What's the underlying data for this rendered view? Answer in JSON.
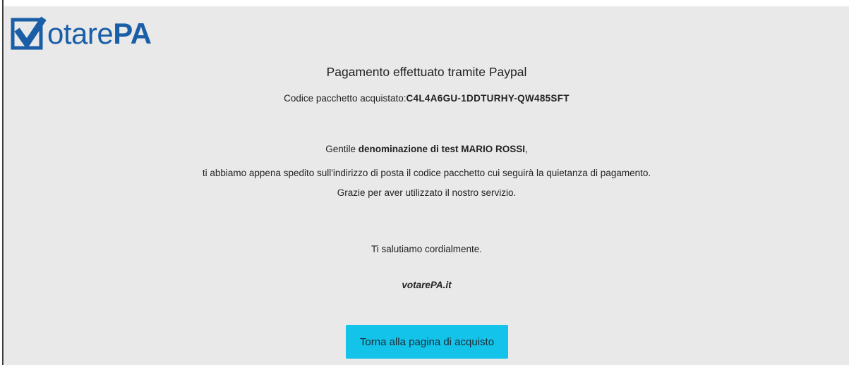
{
  "logo": {
    "text_light": "otare",
    "text_bold": "PA",
    "brand_color": "#1a5ea8",
    "icon": "checkmark-icon"
  },
  "payment": {
    "title": "Pagamento effettuato tramite Paypal",
    "code_label": "Codice pacchetto acquistato:",
    "code_value": "C4L4A6GU-1DDTURHY-QW485SFT"
  },
  "message": {
    "greeting_prefix": "Gentile ",
    "recipient_name": "denominazione di test MARIO ROSSI",
    "greeting_suffix": ",",
    "line_1": "ti abbiamo appena spedito sull'indirizzo di posta il codice pacchetto cui seguirà la quietanza di pagamento.",
    "line_2": "Grazie per aver utilizzato il nostro servizio.",
    "salute": "Ti salutiamo cordialmente.",
    "signature": "votarePA.it"
  },
  "actions": {
    "back_label": "Torna alla pagina di acquisto",
    "button_color": "#14c3ea"
  }
}
